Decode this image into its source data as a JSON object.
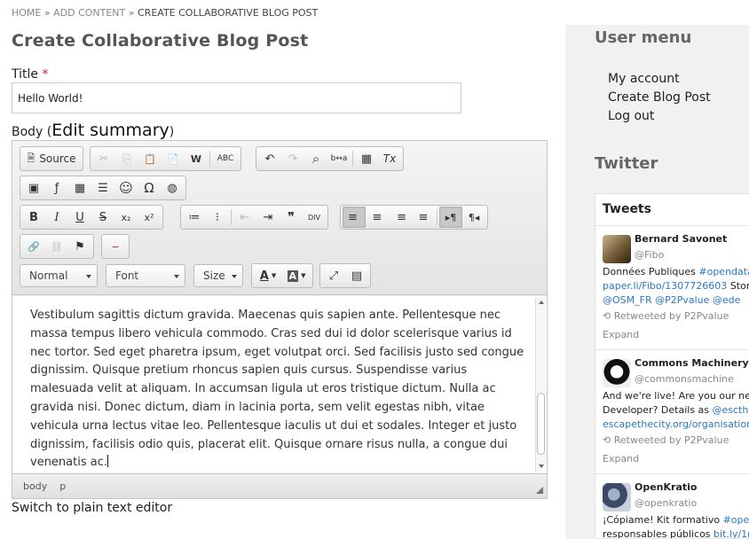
{
  "breadcrumb": {
    "home": "HOME",
    "sep": "»",
    "add_content": "ADD CONTENT",
    "current": "CREATE COLLABORATIVE BLOG POST"
  },
  "page": {
    "title": "Create Collaborative Blog Post"
  },
  "form": {
    "title_label": "Title",
    "required_mark": "*",
    "title_value": "Hello World!",
    "body_label": "Body (",
    "edit_summary": "Edit summary",
    "body_label_close": ")",
    "switch_editor": "Switch to plain text editor"
  },
  "editor": {
    "source_label": "Source",
    "format_combo": "Normal",
    "font_combo": "Font",
    "size_combo": "Size",
    "content": "Vestibulum sagittis dictum gravida. Maecenas quis sapien ante. Pellentesque nec massa tempus libero vehicula commodo. Cras sed dui id dolor scelerisque varius id nec tortor. Sed eget pharetra ipsum, eget volutpat orci. Sed facilisis justo sed congue dignissim. Quisque pretium rhoncus sapien quis cursus. Suspendisse varius malesuada velit at aliquam. In accumsan ligula ut eros tristique dictum. Nulla ac gravida nisi. Donec dictum, diam in lacinia porta, sem velit egestas nibh, vitae vehicula urna lectus vitae leo. Pellentesque iaculis ut dui et sodales. Integer et justo dignissim, facilisis odio quis, placerat elit. Quisque ornare risus nulla, a congue dui venenatis ac.",
    "path_body": "body",
    "path_p": "p",
    "toolbar": {
      "cut": "✂",
      "copy": "⎘",
      "paste": "📋",
      "paste_text": "📄",
      "paste_word": "W",
      "spellcheck": "ABC",
      "undo": "↶",
      "redo": "↷",
      "find": "⌕",
      "replace": "b↔a",
      "select_all": "▦",
      "remove_format": "Tx",
      "image": "▣",
      "flash": "ƒ",
      "table": "▦",
      "hline": "☰",
      "smiley": "☺",
      "omega": "Ω",
      "iframe": "◍",
      "bold": "B",
      "italic": "I",
      "underline": "U",
      "strike": "S",
      "subscript": "x₂",
      "superscript": "x²",
      "ol": "≔",
      "ul": "⁝",
      "outdent": "⇤",
      "indent": "⇥",
      "blockquote": "❞",
      "div": "DIV",
      "align_left": "≡",
      "align_center": "≡",
      "align_right": "≡",
      "justify": "≡",
      "ltr": "▸¶",
      "rtl": "¶◂",
      "link": "🔗",
      "unlink": "⛓",
      "anchor": "⚑",
      "pagebreak": "⎯",
      "text_color": "A",
      "bg_color": "A",
      "maximize": "⤢",
      "blocks": "▤"
    }
  },
  "sidebar": {
    "user_menu_title": "User menu",
    "user_menu_items": [
      "My account",
      "Create Blog Post",
      "Log out"
    ],
    "twitter_title": "Twitter",
    "tweets_header": "Tweets",
    "tweets": [
      {
        "name": "Bernard Savonet",
        "handle": "@Fibo",
        "line1_text": "Données Publiques ",
        "line1_link": "#opendata",
        "line2_link": "paper.li/Fibo/1307726603",
        "line2_text": " Stor",
        "line3_link": "@OSM_FR @P2Pvalue @ede",
        "retweet": "Retweeted by P2Pvalue",
        "expand": "Expand"
      },
      {
        "name": "Commons Machinery",
        "handle": "@commonsmachine",
        "line1_text": "And we're live! Are you our new",
        "line2_text": "Developer? Details as ",
        "line2_link": "@escth",
        "line3_link": "escapethecity.org/organisation",
        "retweet": "Retweeted by P2Pvalue",
        "expand": "Expand"
      },
      {
        "name": "OpenKratio",
        "handle": "@openkratio",
        "line1_text": "¡Cópiame! Kit formativo ",
        "line1_link": "#ope",
        "line2_text": "responsables públicos ",
        "line2_link": "bit.ly/1r"
      }
    ]
  },
  "colors": {
    "link": "#2a78c6",
    "sidebar_bg": "#f1f1f1",
    "heading_gray": "#555555",
    "required": "#dd2222"
  }
}
